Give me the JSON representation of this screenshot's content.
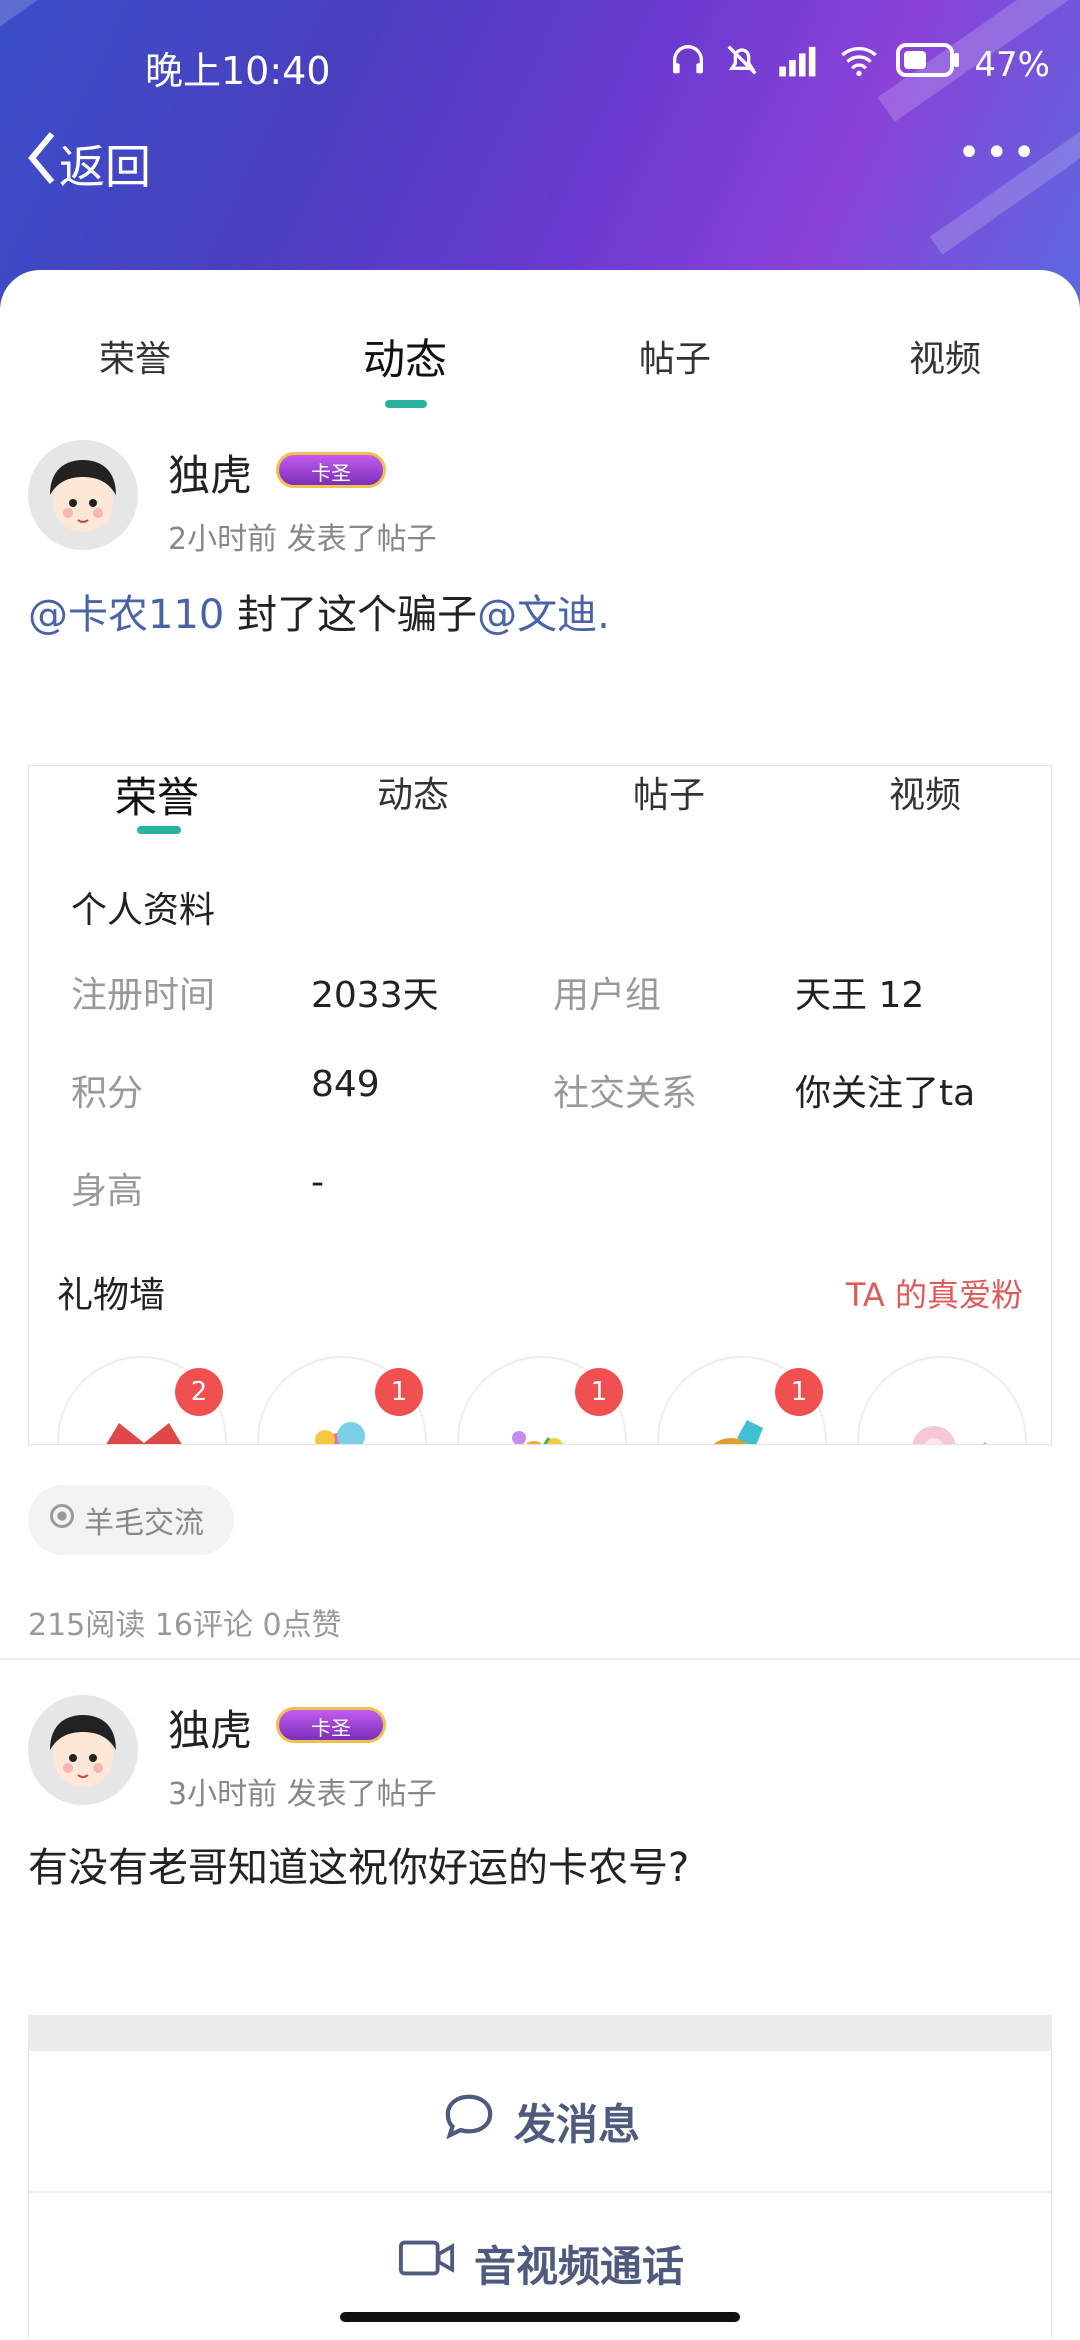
{
  "status": {
    "time": "晚上10:40",
    "battery": "47%"
  },
  "nav": {
    "back_label": "返回",
    "more_label": "•••"
  },
  "tabs": [
    "荣誉",
    "动态",
    "帖子",
    "视频"
  ],
  "posts": [
    {
      "username": "独虎",
      "badge": "卡圣",
      "meta": "2小时前  发表了帖子",
      "mention1": "@卡农110",
      "text_mid": " 封了这个骗子",
      "mention2": "@文迪."
    },
    {
      "username": "独虎",
      "badge": "卡圣",
      "meta": "3小时前  发表了帖子",
      "text": "有没有老哥知道这祝你好运的卡农号?"
    }
  ],
  "screenshot": {
    "tabs": [
      "荣誉",
      "动态",
      "帖子",
      "视频"
    ],
    "section_title": "个人资料",
    "rows": [
      {
        "l1": "注册时间",
        "v1": "2033天",
        "l2": "用户组",
        "v2": "天王 12"
      },
      {
        "l1": "积分",
        "v1": "849",
        "l2": "社交关系",
        "v2": "你关注了ta"
      },
      {
        "l1": "身高",
        "v1": "-",
        "l2": "",
        "v2": ""
      }
    ],
    "gift_title": "礼物墙",
    "gift_link": "TA 的真爱粉",
    "gift_counts": [
      "2",
      "1",
      "1",
      "1"
    ]
  },
  "tag": "羊毛交流",
  "stats": "215阅读  16评论  0点赞",
  "actions": {
    "message": "发消息",
    "call": "音视频通话"
  },
  "colors": {
    "accent": "#2bb3a0",
    "mention": "#4a63a8"
  }
}
